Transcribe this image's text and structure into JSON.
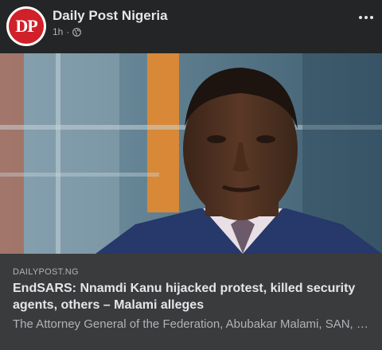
{
  "post": {
    "page_name": "Daily Post Nigeria",
    "avatar_initials": "DP",
    "time": "1h",
    "separator": "·",
    "privacy_icon": "globe-icon",
    "more_icon": "more-options-icon"
  },
  "link": {
    "image_description": "photo-thumbnail",
    "domain": "DAILYPOST.NG",
    "headline": "EndSARS: Nnamdi Kanu hijacked protest, killed security agents, others – Malami alleges",
    "description": "The Attorney General of the Federation, Abubakar Malami, SAN, has alleged that..."
  },
  "colors": {
    "background": "#242526",
    "preview_background": "#3a3b3c",
    "avatar_red": "#d0202a",
    "primary_text": "#e4e6eb",
    "secondary_text": "#b0b3b8"
  }
}
